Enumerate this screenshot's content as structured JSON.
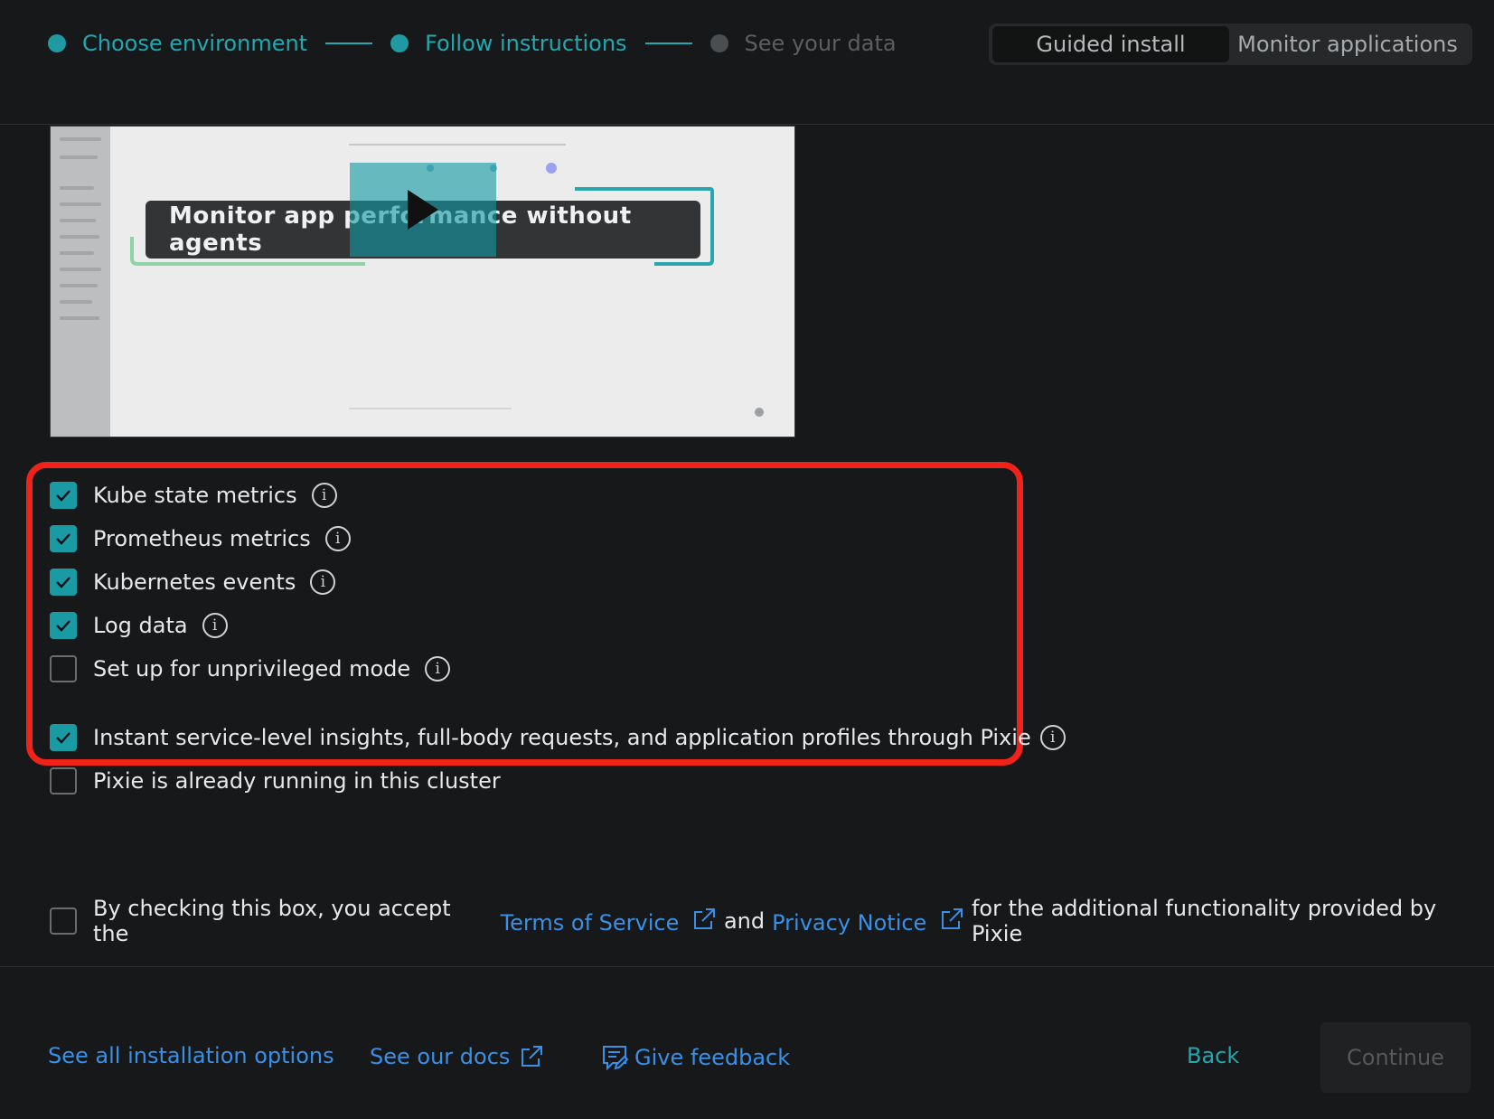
{
  "stepper": {
    "steps": [
      {
        "label": "Choose environment",
        "state": "done"
      },
      {
        "label": "Follow instructions",
        "state": "active"
      },
      {
        "label": "See your data",
        "state": "pending"
      }
    ]
  },
  "mode_toggle": {
    "guided_install": "Guided install",
    "monitor_applications": "Monitor applications",
    "selected": "Guided install"
  },
  "video": {
    "banner_text": "Monitor app performance without agents",
    "play_icon": "play-icon"
  },
  "options": [
    {
      "label": "Kube state metrics",
      "checked": true,
      "info": "i"
    },
    {
      "label": "Prometheus metrics",
      "checked": true,
      "info": "i"
    },
    {
      "label": "Kubernetes events",
      "checked": true,
      "info": "i"
    },
    {
      "label": "Log data",
      "checked": true,
      "info": "i"
    },
    {
      "label": "Set up for unprivileged mode",
      "checked": false,
      "info": "i"
    },
    {
      "label": "Instant service-level insights, full-body requests, and application profiles through Pixie",
      "checked": true,
      "info": "i"
    },
    {
      "label": "Pixie is already running in this cluster",
      "checked": false
    }
  ],
  "terms": {
    "prefix": "By checking this box, you accept the",
    "tos_link": "Terms of Service",
    "and": "and",
    "privacy_link": "Privacy Notice",
    "suffix": "for the additional functionality provided by Pixie",
    "checked": false
  },
  "footer": {
    "installation_options": "See all installation options",
    "docs": "See our docs",
    "feedback": "Give feedback",
    "back": "Back",
    "continue": "Continue"
  },
  "colors": {
    "accent": "#1a9ba4",
    "link": "#3a8fe6",
    "highlight": "#f0231b",
    "background": "#171819"
  }
}
